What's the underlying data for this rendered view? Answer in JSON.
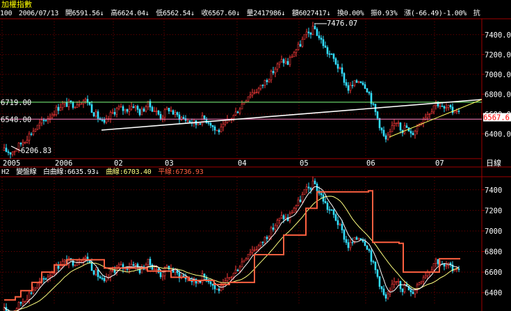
{
  "app": {
    "title": "加權指數"
  },
  "info_bar": {
    "code": "100",
    "date": "2006/07/13",
    "open": "開6591.56↓",
    "high": "高6624.04↓",
    "low": "低6562.54↓",
    "close": "收6567.60↓",
    "volume": "量2417986↓",
    "amount": "額6027417↓",
    "turnover": "換0.00%",
    "amplitude": "振0.93%",
    "change": "漲(-66.49)-1.00%",
    "tail": "抗"
  },
  "upper_chart": {
    "y_ticks": [
      "7400.00",
      "7200.00",
      "7000.00",
      "6800.00",
      "6600.00",
      "6400.00"
    ],
    "x_ticks": [
      "2005",
      "2006",
      "02",
      "03",
      "04",
      "05",
      "06",
      "07"
    ],
    "x_axis_unit": "日線",
    "ref_line_1": "6719.00",
    "ref_line_2": "6548.00",
    "last_price_tag": "6567.6",
    "peak_label": "7476.07",
    "trough_label": "6206.83"
  },
  "lower_chart": {
    "indicator": "H2",
    "indicator_name": "變盤線",
    "white_line": "白曲線:6635.93↓",
    "curve_line": "曲線:6703.40",
    "flat_line": "平線:6736.93",
    "y_ticks": [
      "7400",
      "7200",
      "7000",
      "6800",
      "6600",
      "6400"
    ]
  },
  "colors": {
    "up": "#ff3b3b",
    "down": "#33e0ff",
    "grid": "#7a0000",
    "white_curve": "#ffffff",
    "curve": "#ffff80",
    "flat_line": "#ff6040",
    "ref_line_1": "#80ff80",
    "ref_line_2": "#ff80c0",
    "trend_line": "#ffffff",
    "title": "#ffff00"
  }
}
